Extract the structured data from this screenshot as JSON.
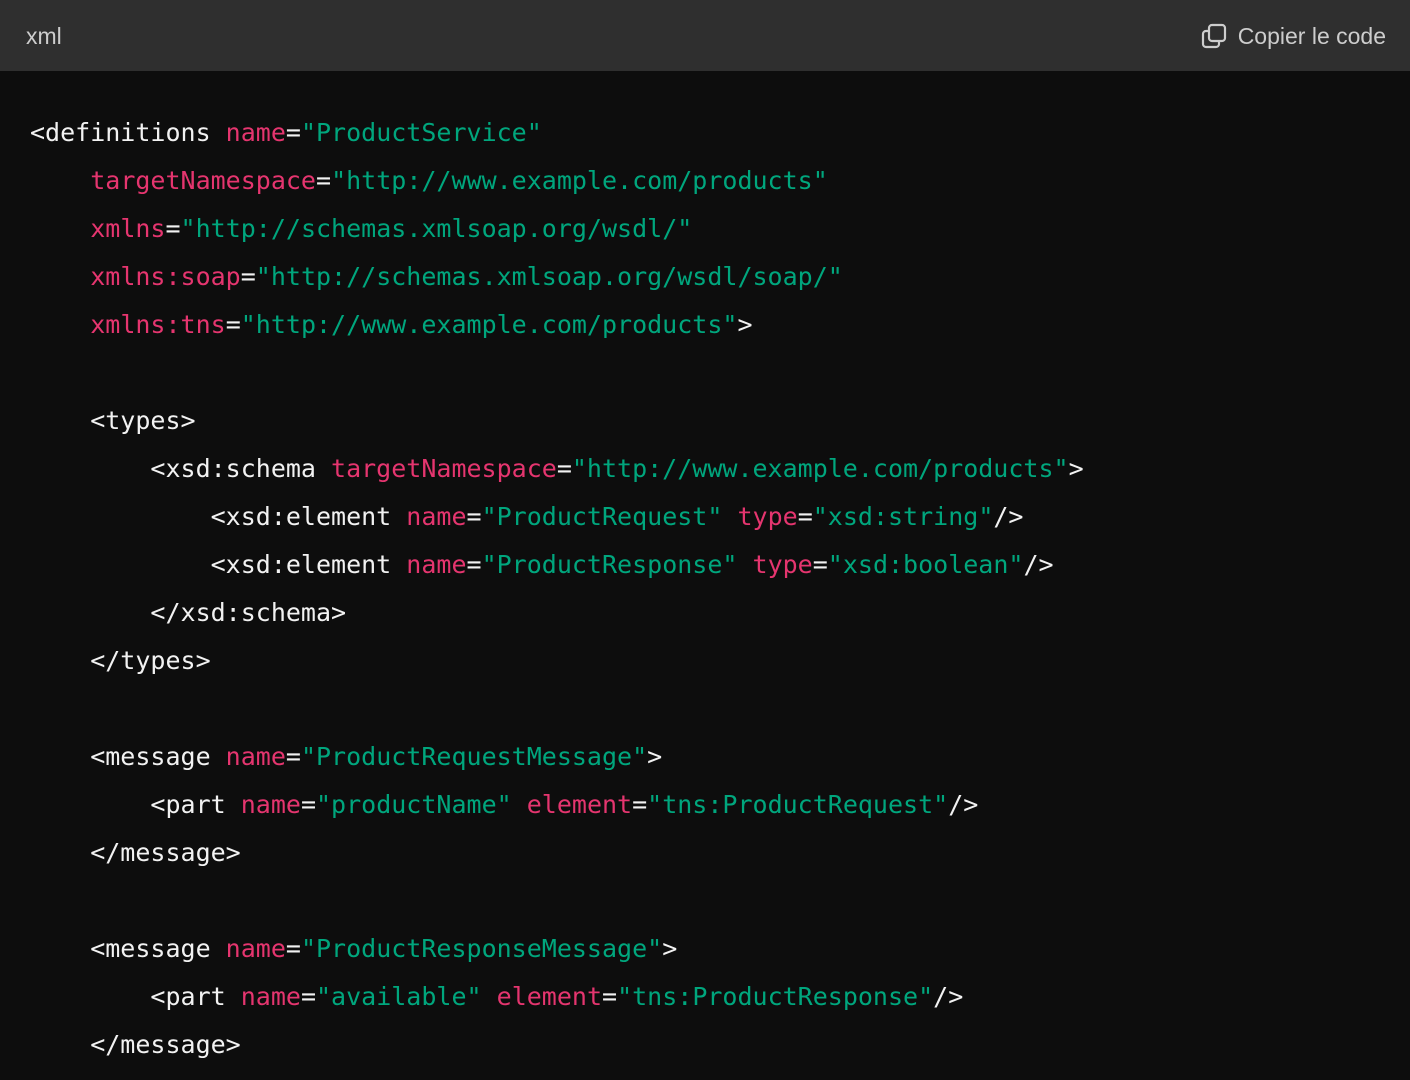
{
  "header": {
    "language": "xml",
    "copy_label": "Copier le code",
    "copy_icon": "copy-icon"
  },
  "colors": {
    "header_bg": "#2f2f2f",
    "code_bg": "#0d0d0d",
    "tag": "#f2f2f2",
    "attribute": "#e5356f",
    "string": "#00a67d"
  },
  "code_lines": [
    [
      {
        "t": "tag",
        "v": "<definitions "
      },
      {
        "t": "attr",
        "v": "name"
      },
      {
        "t": "eq",
        "v": "="
      },
      {
        "t": "str",
        "v": "\"ProductService\""
      }
    ],
    [
      {
        "t": "tag",
        "v": "    "
      },
      {
        "t": "attr",
        "v": "targetNamespace"
      },
      {
        "t": "eq",
        "v": "="
      },
      {
        "t": "str",
        "v": "\"http://www.example.com/products\""
      }
    ],
    [
      {
        "t": "tag",
        "v": "    "
      },
      {
        "t": "attr",
        "v": "xmlns"
      },
      {
        "t": "eq",
        "v": "="
      },
      {
        "t": "str",
        "v": "\"http://schemas.xmlsoap.org/wsdl/\""
      }
    ],
    [
      {
        "t": "tag",
        "v": "    "
      },
      {
        "t": "attr",
        "v": "xmlns:soap"
      },
      {
        "t": "eq",
        "v": "="
      },
      {
        "t": "str",
        "v": "\"http://schemas.xmlsoap.org/wsdl/soap/\""
      }
    ],
    [
      {
        "t": "tag",
        "v": "    "
      },
      {
        "t": "attr",
        "v": "xmlns:tns"
      },
      {
        "t": "eq",
        "v": "="
      },
      {
        "t": "str",
        "v": "\"http://www.example.com/products\""
      },
      {
        "t": "tag",
        "v": ">"
      }
    ],
    [],
    [
      {
        "t": "tag",
        "v": "    <types>"
      }
    ],
    [
      {
        "t": "tag",
        "v": "        <xsd:schema "
      },
      {
        "t": "attr",
        "v": "targetNamespace"
      },
      {
        "t": "eq",
        "v": "="
      },
      {
        "t": "str",
        "v": "\"http://www.example.com/products\""
      },
      {
        "t": "tag",
        "v": ">"
      }
    ],
    [
      {
        "t": "tag",
        "v": "            <xsd:element "
      },
      {
        "t": "attr",
        "v": "name"
      },
      {
        "t": "eq",
        "v": "="
      },
      {
        "t": "str",
        "v": "\"ProductRequest\""
      },
      {
        "t": "tag",
        "v": " "
      },
      {
        "t": "attr",
        "v": "type"
      },
      {
        "t": "eq",
        "v": "="
      },
      {
        "t": "str",
        "v": "\"xsd:string\""
      },
      {
        "t": "tag",
        "v": "/>"
      }
    ],
    [
      {
        "t": "tag",
        "v": "            <xsd:element "
      },
      {
        "t": "attr",
        "v": "name"
      },
      {
        "t": "eq",
        "v": "="
      },
      {
        "t": "str",
        "v": "\"ProductResponse\""
      },
      {
        "t": "tag",
        "v": " "
      },
      {
        "t": "attr",
        "v": "type"
      },
      {
        "t": "eq",
        "v": "="
      },
      {
        "t": "str",
        "v": "\"xsd:boolean\""
      },
      {
        "t": "tag",
        "v": "/>"
      }
    ],
    [
      {
        "t": "tag",
        "v": "        </xsd:schema>"
      }
    ],
    [
      {
        "t": "tag",
        "v": "    </types>"
      }
    ],
    [],
    [
      {
        "t": "tag",
        "v": "    <message "
      },
      {
        "t": "attr",
        "v": "name"
      },
      {
        "t": "eq",
        "v": "="
      },
      {
        "t": "str",
        "v": "\"ProductRequestMessage\""
      },
      {
        "t": "tag",
        "v": ">"
      }
    ],
    [
      {
        "t": "tag",
        "v": "        <part "
      },
      {
        "t": "attr",
        "v": "name"
      },
      {
        "t": "eq",
        "v": "="
      },
      {
        "t": "str",
        "v": "\"productName\""
      },
      {
        "t": "tag",
        "v": " "
      },
      {
        "t": "attr",
        "v": "element"
      },
      {
        "t": "eq",
        "v": "="
      },
      {
        "t": "str",
        "v": "\"tns:ProductRequest\""
      },
      {
        "t": "tag",
        "v": "/>"
      }
    ],
    [
      {
        "t": "tag",
        "v": "    </message>"
      }
    ],
    [],
    [
      {
        "t": "tag",
        "v": "    <message "
      },
      {
        "t": "attr",
        "v": "name"
      },
      {
        "t": "eq",
        "v": "="
      },
      {
        "t": "str",
        "v": "\"ProductResponseMessage\""
      },
      {
        "t": "tag",
        "v": ">"
      }
    ],
    [
      {
        "t": "tag",
        "v": "        <part "
      },
      {
        "t": "attr",
        "v": "name"
      },
      {
        "t": "eq",
        "v": "="
      },
      {
        "t": "str",
        "v": "\"available\""
      },
      {
        "t": "tag",
        "v": " "
      },
      {
        "t": "attr",
        "v": "element"
      },
      {
        "t": "eq",
        "v": "="
      },
      {
        "t": "str",
        "v": "\"tns:ProductResponse\""
      },
      {
        "t": "tag",
        "v": "/>"
      }
    ],
    [
      {
        "t": "tag",
        "v": "    </message>"
      }
    ]
  ]
}
